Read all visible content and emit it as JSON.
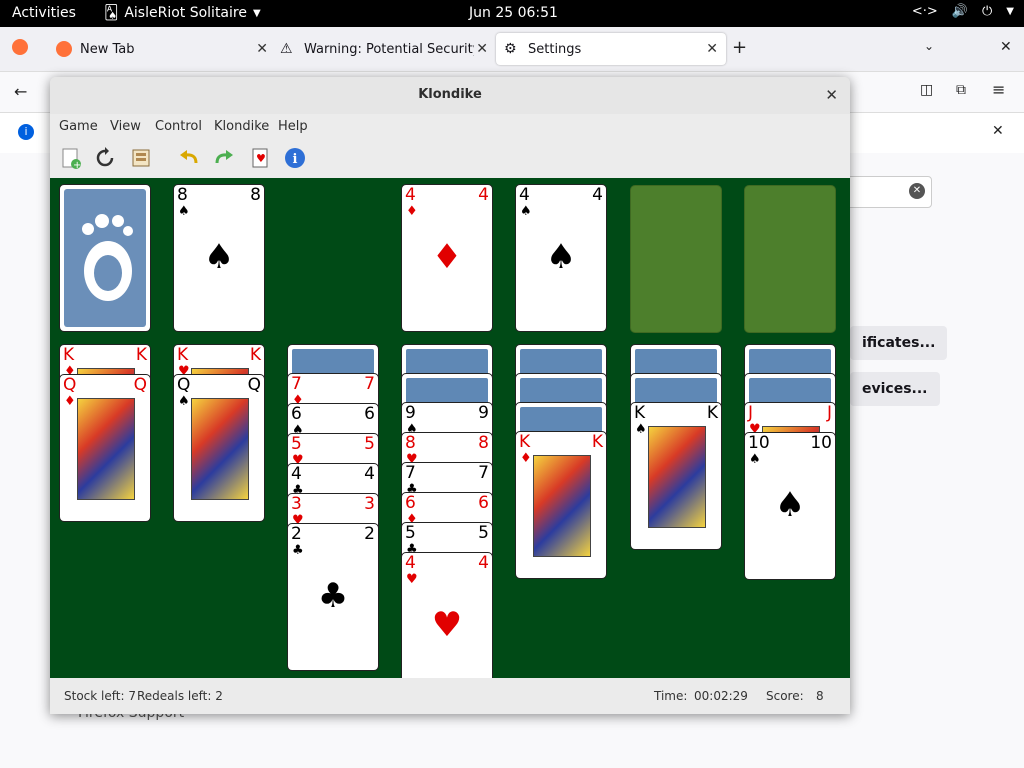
{
  "topbar": {
    "activities": "Activities",
    "app_name": "AisleRiot Solitaire",
    "clock": "Jun 25  06:51"
  },
  "firefox": {
    "tabs": [
      {
        "label": "New Tab"
      },
      {
        "label": "Warning: Potential Security Ri"
      },
      {
        "label": "Settings"
      }
    ],
    "content_buttons": [
      "ificates...",
      "evices..."
    ],
    "footer_link": "Firefox Support"
  },
  "window": {
    "title": "Klondike",
    "menu": [
      "Game",
      "View",
      "Control",
      "Klondike",
      "Help"
    ],
    "toolbar": [
      "new-game-icon",
      "restart-icon",
      "select-game-icon",
      "undo-icon",
      "redo-icon",
      "hint-icon",
      "info-icon"
    ]
  },
  "status": {
    "stock_left": "Stock left: 7",
    "redeals_left": "Redeals left: 2",
    "time_label": "Time:",
    "time_value": "00:02:29",
    "score_label": "Score:",
    "score_value": "8"
  },
  "game": {
    "waste": {
      "rank": "8",
      "suit": "♠",
      "color": "black"
    },
    "foundations": [
      {
        "rank": "4",
        "suit": "♦",
        "color": "red"
      },
      {
        "rank": "4",
        "suit": "♠",
        "color": "black"
      },
      null,
      null
    ],
    "tableau": [
      {
        "down": 0,
        "up": [
          {
            "rank": "K",
            "suit": "♦",
            "color": "red"
          },
          {
            "rank": "Q",
            "suit": "♦",
            "color": "red"
          }
        ]
      },
      {
        "down": 0,
        "up": [
          {
            "rank": "K",
            "suit": "♥",
            "color": "red"
          },
          {
            "rank": "Q",
            "suit": "♠",
            "color": "black"
          }
        ]
      },
      {
        "down": 1,
        "up": [
          {
            "rank": "7",
            "suit": "♦",
            "color": "red"
          },
          {
            "rank": "6",
            "suit": "♠",
            "color": "black"
          },
          {
            "rank": "5",
            "suit": "♥",
            "color": "red"
          },
          {
            "rank": "4",
            "suit": "♣",
            "color": "black"
          },
          {
            "rank": "3",
            "suit": "♥",
            "color": "red"
          },
          {
            "rank": "2",
            "suit": "♣",
            "color": "black"
          }
        ]
      },
      {
        "down": 2,
        "up": [
          {
            "rank": "9",
            "suit": "♠",
            "color": "black"
          },
          {
            "rank": "8",
            "suit": "♥",
            "color": "red"
          },
          {
            "rank": "7",
            "suit": "♣",
            "color": "black"
          },
          {
            "rank": "6",
            "suit": "♦",
            "color": "red"
          },
          {
            "rank": "5",
            "suit": "♣",
            "color": "black"
          },
          {
            "rank": "4",
            "suit": "♥",
            "color": "red"
          }
        ]
      },
      {
        "down": 3,
        "up": [
          {
            "rank": "K",
            "suit": "♦",
            "color": "red"
          }
        ]
      },
      {
        "down": 2,
        "up": [
          {
            "rank": "K",
            "suit": "♠",
            "color": "black"
          }
        ]
      },
      {
        "down": 2,
        "up": [
          {
            "rank": "J",
            "suit": "♥",
            "color": "red"
          },
          {
            "rank": "10",
            "suit": "♠",
            "color": "black"
          }
        ]
      }
    ]
  }
}
